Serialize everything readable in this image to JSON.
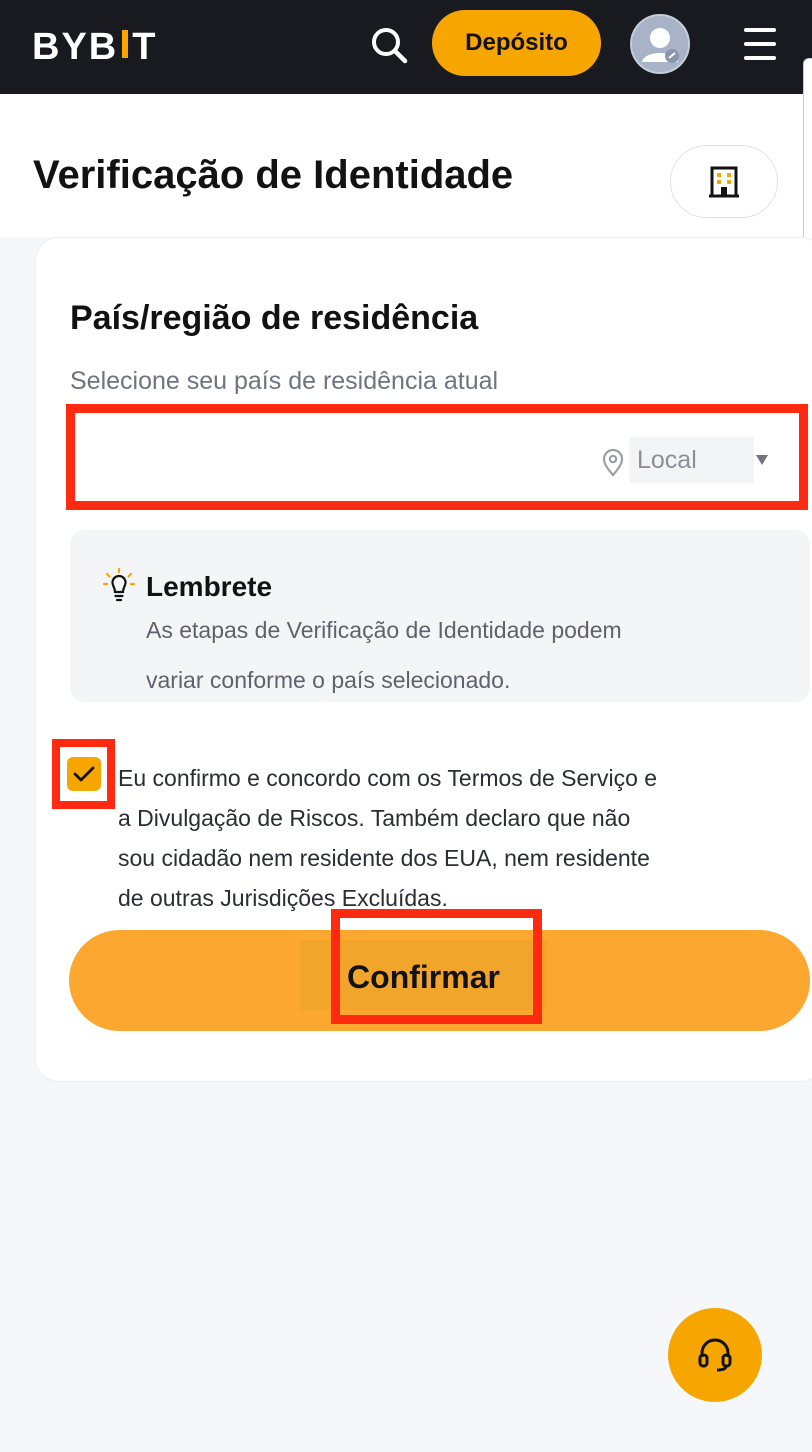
{
  "header": {
    "logo": "BYB",
    "logo_tail": "T",
    "deposit_label": "Depósito",
    "icons": [
      "search-icon",
      "user-avatar-icon",
      "menu-icon"
    ]
  },
  "page": {
    "title": "Verificação de Identidade",
    "building_icon": "building-icon"
  },
  "residence": {
    "title": "País/região de residência",
    "subtitle": "Selecione seu país de residência atual",
    "select_value": "",
    "location_label": "Local"
  },
  "reminder": {
    "title": "Lembrete",
    "line1": "As etapas de Verificação de Identidade podem",
    "line2": "variar conforme o país selecionado."
  },
  "consent": {
    "checked": true,
    "line1": "Eu confirmo e concordo com os Termos de Serviço e",
    "line2": "a Divulgação de Riscos. Também declaro que não",
    "line3": "sou cidadão nem residente dos EUA, nem residente",
    "line4": "de outras Jurisdições Excluídas."
  },
  "actions": {
    "confirm_label": "Confirmar"
  },
  "colors": {
    "brand": "#f7a600",
    "header_bg": "#181a20",
    "highlight": "#ff2a10"
  }
}
